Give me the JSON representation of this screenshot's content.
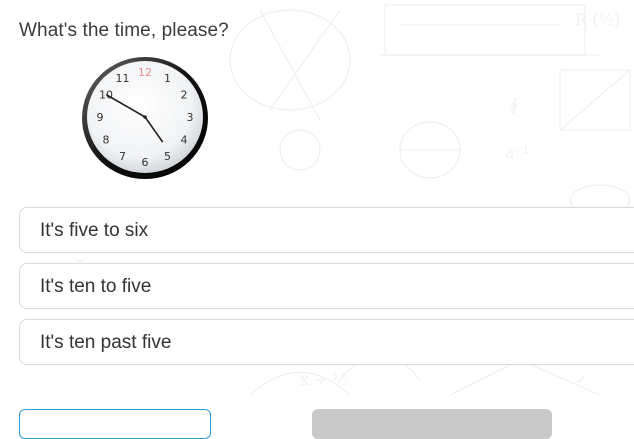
{
  "question": {
    "text": "What's the time, please?"
  },
  "clock": {
    "numbers": [
      "12",
      "1",
      "2",
      "3",
      "4",
      "5",
      "6",
      "7",
      "8",
      "9",
      "10",
      "11"
    ],
    "hour_hand_value": 4.83,
    "minute_hand_value": 50,
    "twelve_color": "#e88d8d"
  },
  "options": [
    {
      "label": "It's five to six"
    },
    {
      "label": "It's ten to five"
    },
    {
      "label": "It's ten past five"
    }
  ],
  "buttons": {
    "outline_color": "#2a9fd6",
    "disabled_color": "#c9c9c9"
  }
}
